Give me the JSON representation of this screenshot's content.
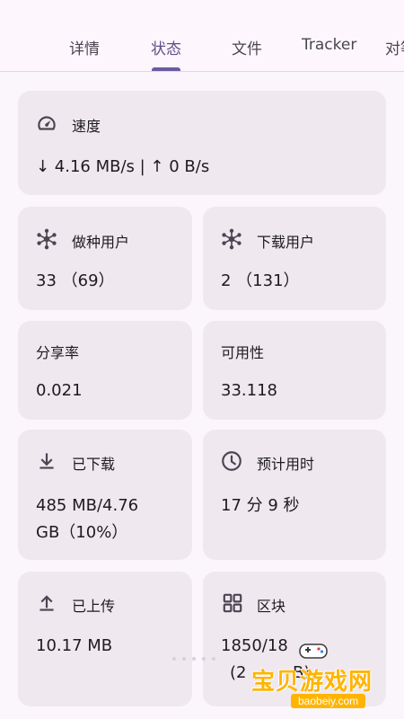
{
  "tabs": [
    {
      "label": "详情"
    },
    {
      "label": "状态"
    },
    {
      "label": "文件"
    },
    {
      "label": "Tracker"
    },
    {
      "label": "对等"
    }
  ],
  "active_tab": "状态",
  "speed": {
    "title": "速度",
    "value": "↓ 4.16 MB/s | ↑ 0 B/s"
  },
  "seeders": {
    "title": "做种用户",
    "value": "33 （69）"
  },
  "leechers": {
    "title": "下载用户",
    "value": "2 （131）"
  },
  "ratio": {
    "title": "分享率",
    "value": "0.021"
  },
  "availability": {
    "title": "可用性",
    "value": "33.118"
  },
  "downloaded": {
    "title": "已下载",
    "value_line1": "485 MB/4.76",
    "value_line2": "GB（10%）"
  },
  "eta": {
    "title": "预计用时",
    "value": "17 分 9 秒"
  },
  "uploaded": {
    "title": "已上传",
    "value": "10.17 MB"
  },
  "pieces": {
    "title": "区块",
    "value_line1": "1850/18",
    "value_line2": "(2",
    "value_line2b": "B)"
  },
  "watermark": {
    "text": "宝贝游戏网",
    "url": "baobeiy.com"
  },
  "icons": {
    "speed": "speedometer-icon",
    "seeders": "hub-icon",
    "leechers": "hub-icon",
    "downloaded": "download-icon",
    "eta": "clock-icon",
    "uploaded": "upload-icon",
    "pieces": "grid-icon"
  }
}
